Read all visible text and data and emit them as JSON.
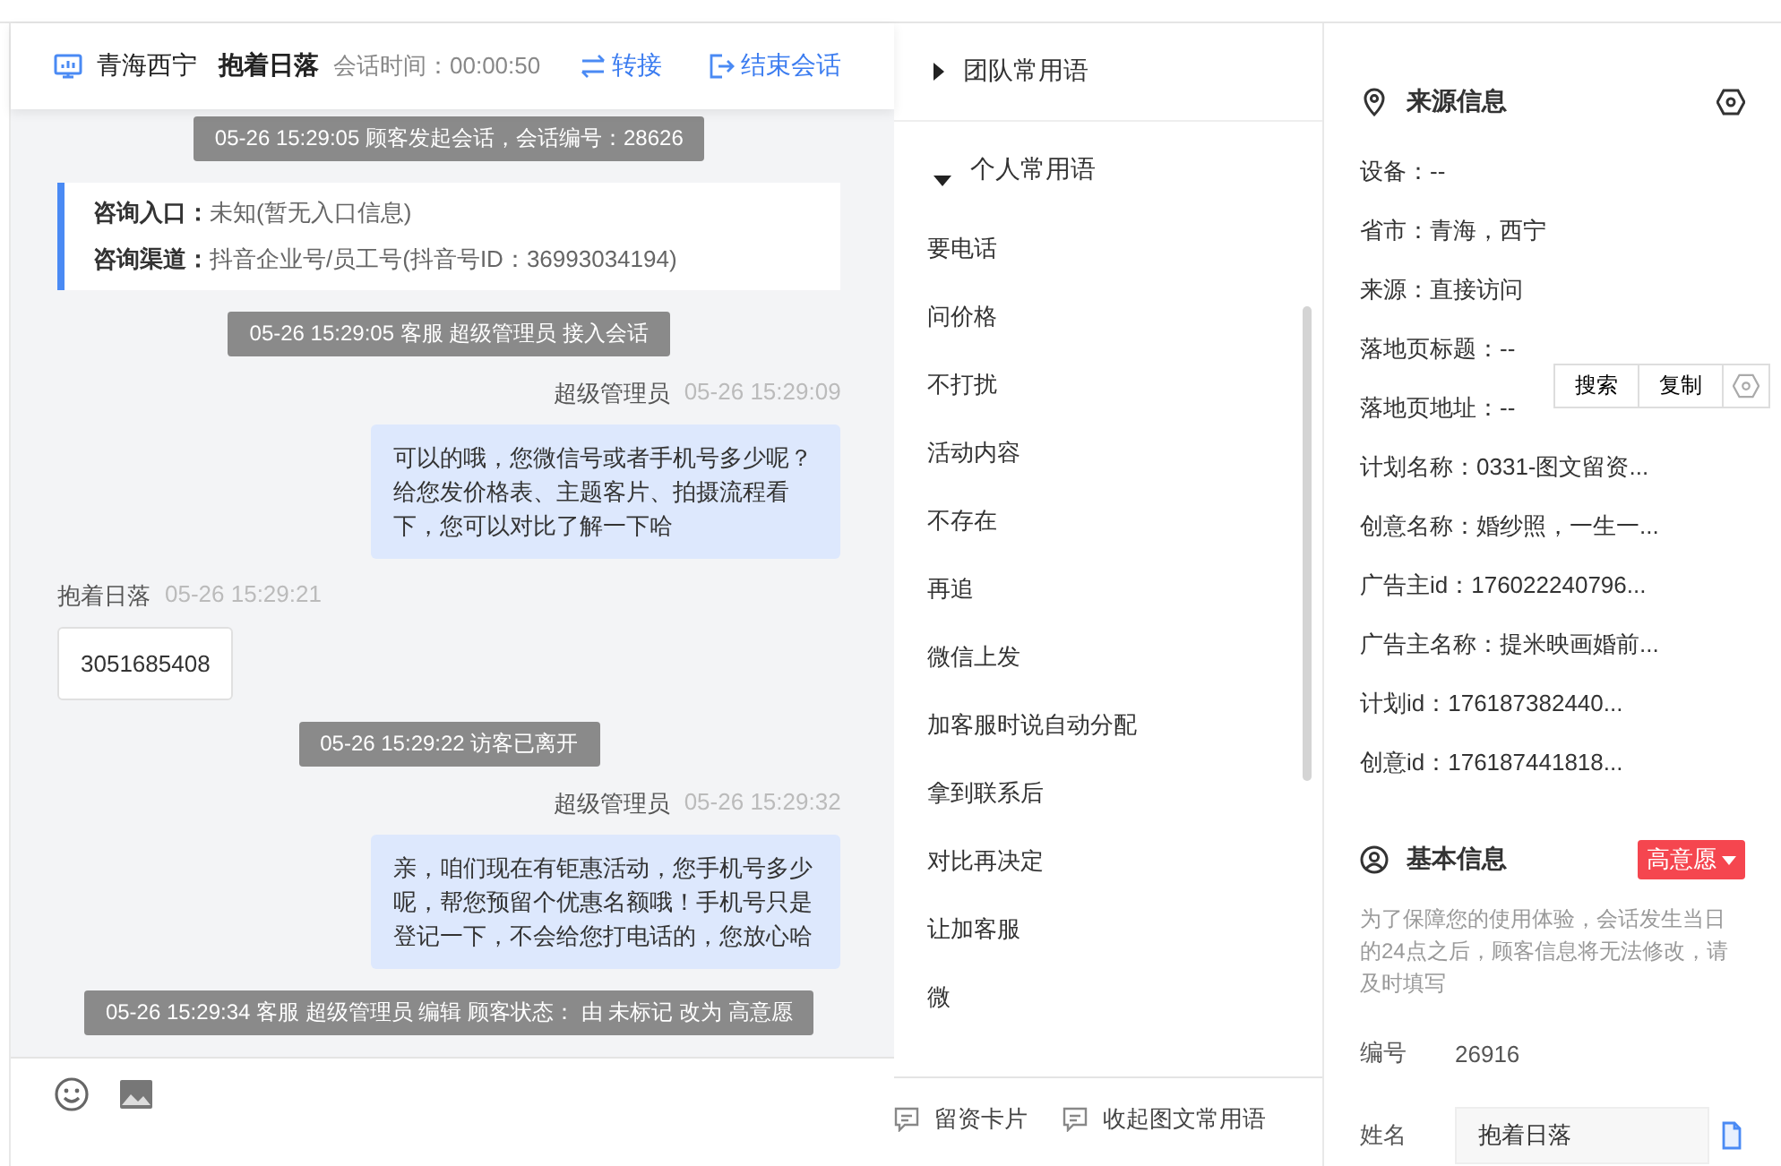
{
  "chat_header": {
    "region": "青海西宁",
    "visitor": "抱着日落",
    "duration_label": "会话时间：00:00:50",
    "transfer": "转接",
    "end": "结束会话"
  },
  "messages": [
    {
      "kind": "system",
      "text": "05-26 15:29:05 顾客发起会话，会话编号：28626"
    },
    {
      "kind": "info",
      "rows": [
        {
          "label": "咨询入口：",
          "value": "未知(暂无入口信息)"
        },
        {
          "label": "咨询渠道：",
          "value": "抖音企业号/员工号(抖音号ID：36993034194)"
        }
      ]
    },
    {
      "kind": "system",
      "text": "05-26 15:29:05 客服 超级管理员 接入会话"
    },
    {
      "kind": "agent",
      "sender": "超级管理员",
      "time": "05-26 15:29:09",
      "text": "可以的哦，您微信号或者手机号多少呢？给您发价格表、主题客片、拍摄流程看下，您可以对比了解一下哈"
    },
    {
      "kind": "visitor",
      "sender": "抱着日落",
      "time": "05-26 15:29:21",
      "text": "3051685408"
    },
    {
      "kind": "system",
      "text": "05-26 15:29:22 访客已离开"
    },
    {
      "kind": "agent",
      "sender": "超级管理员",
      "time": "05-26 15:29:32",
      "text": "亲，咱们现在有钜惠活动，您手机号多少呢，帮您预留个优惠名额哦！手机号只是登记一下，不会给您打电话的，您放心哈"
    },
    {
      "kind": "system",
      "text": "05-26 15:29:34 客服 超级管理员 编辑 顾客状态： 由 未标记 改为 高意愿"
    }
  ],
  "phrase_groups": [
    {
      "title": "团队常用语",
      "expanded": false
    },
    {
      "title": "个人常用语",
      "expanded": true,
      "items": [
        "要电话",
        "问价格",
        "不打扰",
        "活动内容",
        "不存在",
        "再追",
        "微信上发",
        "加客服时说自动分配",
        "拿到联系后",
        "对比再决定",
        "让加客服",
        "微"
      ]
    }
  ],
  "phrase_actions": [
    "留资卡片",
    "收起图文常用语"
  ],
  "source_info": {
    "title": "来源信息",
    "rows": [
      "设备：--",
      "省市：青海，西宁",
      "来源：直接访问",
      "落地页标题：--",
      "落地页地址：--",
      "计划名称：0331-图文留资...",
      "创意名称：婚纱照，一生一...",
      "广告主id：176022240796...",
      "广告主名称：提米映画婚前...",
      "计划id：176187382440...",
      "创意id：176187441818..."
    ]
  },
  "popup": {
    "buttons": [
      "搜索",
      "复制"
    ]
  },
  "basic_info": {
    "title": "基本信息",
    "tag": "高意愿",
    "note": "为了保障您的使用体验，会话发生当日的24点之后，顾客信息将无法修改，请及时填写",
    "fields": [
      {
        "kind": "text",
        "label": "编号",
        "value": "26916"
      },
      {
        "kind": "input",
        "label": "姓名",
        "value": "抱着日落"
      }
    ]
  }
}
